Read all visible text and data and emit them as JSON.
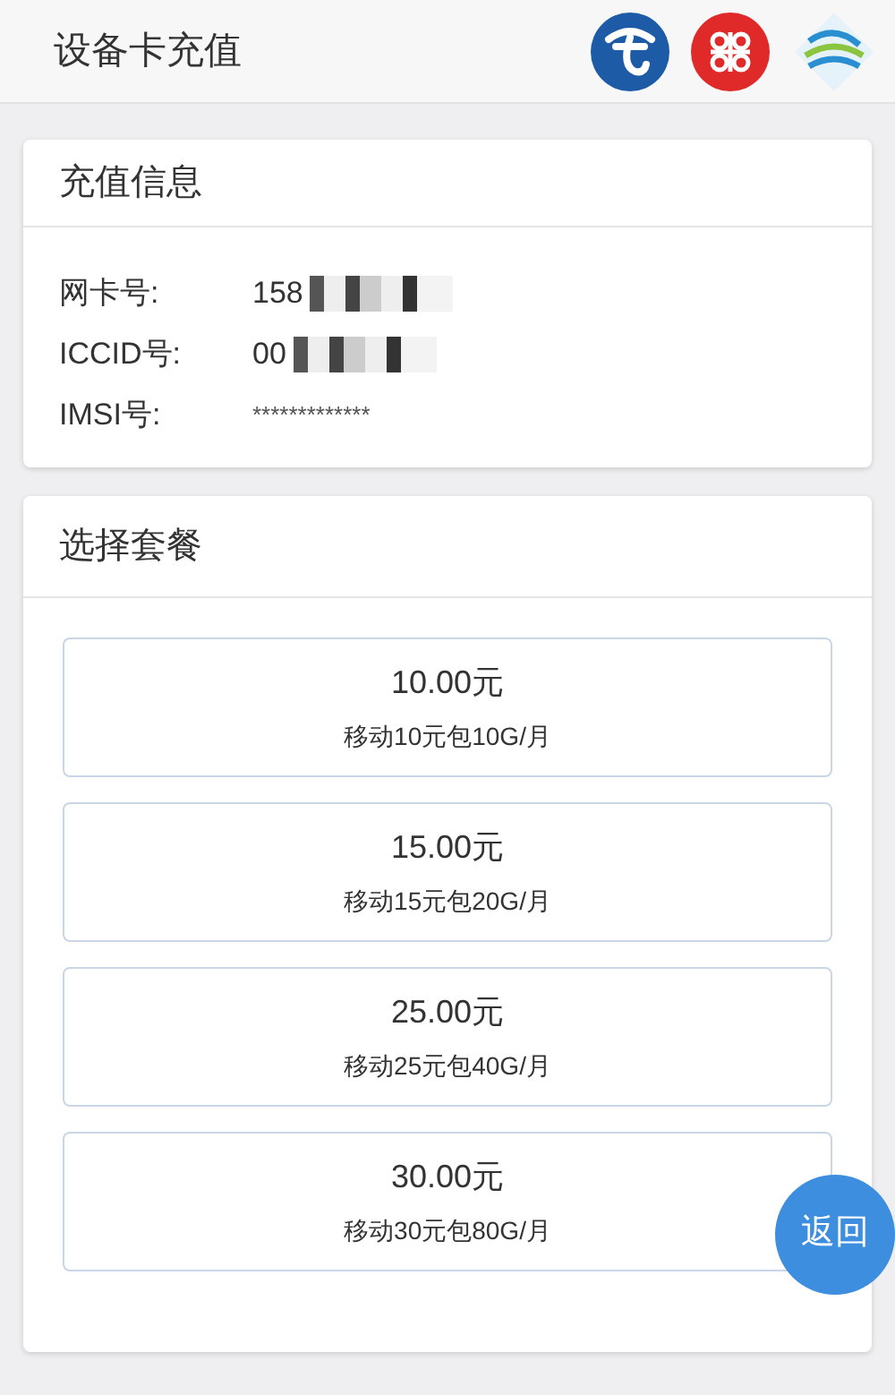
{
  "header": {
    "title": "设备卡充值"
  },
  "info_card": {
    "title": "充值信息",
    "rows": [
      {
        "label": "网卡号:",
        "value": "158",
        "masked": true
      },
      {
        "label": "ICCID号:",
        "value": "00",
        "masked": true
      },
      {
        "label": "IMSI号:",
        "value": "*************",
        "masked": false
      }
    ]
  },
  "plan_card": {
    "title": "选择套餐",
    "plans": [
      {
        "price": "10.00元",
        "name": "移动10元包10G/月"
      },
      {
        "price": "15.00元",
        "name": "移动15元包20G/月"
      },
      {
        "price": "25.00元",
        "name": "移动25元包40G/月"
      },
      {
        "price": "30.00元",
        "name": "移动30元包80G/月"
      }
    ]
  },
  "back_button": {
    "label": "返回"
  }
}
